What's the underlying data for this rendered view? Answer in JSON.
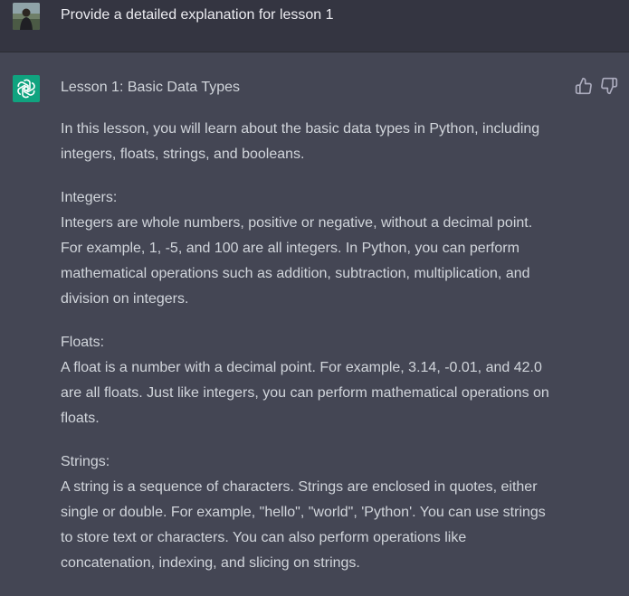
{
  "user": {
    "message": "Provide a detailed explanation for lesson 1"
  },
  "assistant": {
    "paragraphs": [
      "Lesson 1: Basic Data Types",
      "In this lesson, you will learn about the basic data types in Python, including\nintegers, floats, strings, and booleans.",
      "Integers:\nIntegers are whole numbers, positive or negative, without a decimal point.\nFor example, 1, -5, and 100 are all integers. In Python, you can perform\nmathematical operations such as addition, subtraction, multiplication, and\ndivision on integers.",
      "Floats:\nA float is a number with a decimal point. For example, 3.14, -0.01, and 42.0\nare all floats. Just like integers, you can perform mathematical operations on\nfloats.",
      "Strings:\nA string is a sequence of characters. Strings are enclosed in quotes, either\nsingle or double. For example, \"hello\", \"world\", 'Python'. You can use strings\nto store text or characters. You can also perform operations like\nconcatenation, indexing, and slicing on strings."
    ]
  },
  "icons": {
    "user_avatar": "user-avatar-photo",
    "assistant_avatar": "openai-logo-icon",
    "thumbs_up": "thumbs-up-icon",
    "thumbs_down": "thumbs-down-icon"
  },
  "colors": {
    "user_row_bg": "#343541",
    "assistant_row_bg": "#444654",
    "assistant_avatar_bg": "#10a37f",
    "text": "#d1d5db"
  }
}
